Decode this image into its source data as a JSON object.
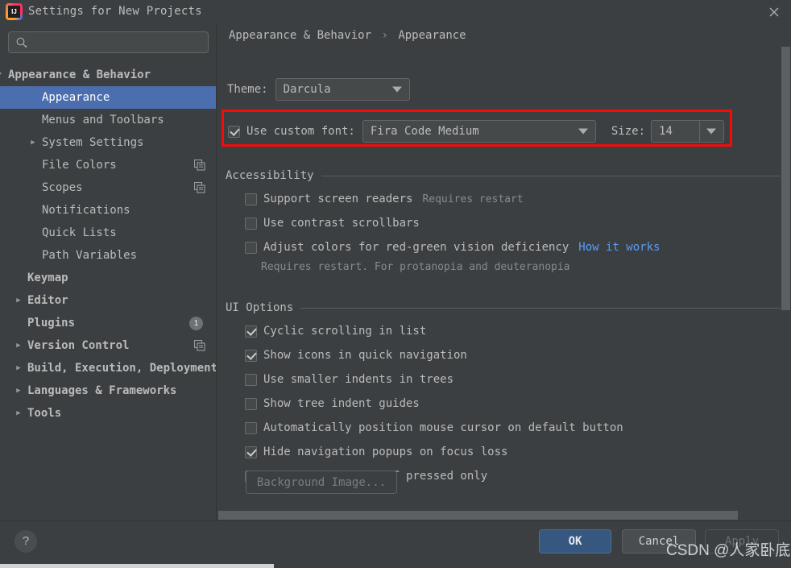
{
  "window": {
    "title": "Settings for New Projects",
    "app_icon": "intellij-idea-icon",
    "close_icon": "close-icon"
  },
  "sidebar": {
    "search": {
      "placeholder": "",
      "value": "",
      "icon": "search-icon"
    },
    "items": [
      {
        "label": "Appearance & Behavior",
        "indent": 10,
        "arrow": "down",
        "selected": false,
        "badge": null,
        "secondary_icon": null,
        "bold": true
      },
      {
        "label": "Appearance",
        "indent": 52,
        "arrow": null,
        "selected": true,
        "badge": null,
        "secondary_icon": null,
        "bold": false
      },
      {
        "label": "Menus and Toolbars",
        "indent": 52,
        "arrow": null,
        "selected": false,
        "badge": null,
        "secondary_icon": null,
        "bold": false
      },
      {
        "label": "System Settings",
        "indent": 52,
        "arrow": "right",
        "selected": false,
        "badge": null,
        "secondary_icon": null,
        "bold": false
      },
      {
        "label": "File Colors",
        "indent": 52,
        "arrow": null,
        "selected": false,
        "badge": null,
        "secondary_icon": "copy-icon",
        "bold": false
      },
      {
        "label": "Scopes",
        "indent": 52,
        "arrow": null,
        "selected": false,
        "badge": null,
        "secondary_icon": "copy-icon",
        "bold": false
      },
      {
        "label": "Notifications",
        "indent": 52,
        "arrow": null,
        "selected": false,
        "badge": null,
        "secondary_icon": null,
        "bold": false
      },
      {
        "label": "Quick Lists",
        "indent": 52,
        "arrow": null,
        "selected": false,
        "badge": null,
        "secondary_icon": null,
        "bold": false
      },
      {
        "label": "Path Variables",
        "indent": 52,
        "arrow": null,
        "selected": false,
        "badge": null,
        "secondary_icon": null,
        "bold": false
      },
      {
        "label": "Keymap",
        "indent": 34,
        "arrow": null,
        "selected": false,
        "badge": null,
        "secondary_icon": null,
        "bold": true
      },
      {
        "label": "Editor",
        "indent": 34,
        "arrow": "right",
        "selected": false,
        "badge": null,
        "secondary_icon": null,
        "bold": true
      },
      {
        "label": "Plugins",
        "indent": 34,
        "arrow": null,
        "selected": false,
        "badge": "1",
        "secondary_icon": null,
        "bold": true
      },
      {
        "label": "Version Control",
        "indent": 34,
        "arrow": "right",
        "selected": false,
        "badge": null,
        "secondary_icon": "copy-icon",
        "bold": true
      },
      {
        "label": "Build, Execution, Deployment",
        "indent": 34,
        "arrow": "right",
        "selected": false,
        "badge": null,
        "secondary_icon": null,
        "bold": true
      },
      {
        "label": "Languages & Frameworks",
        "indent": 34,
        "arrow": "right",
        "selected": false,
        "badge": null,
        "secondary_icon": null,
        "bold": true
      },
      {
        "label": "Tools",
        "indent": 34,
        "arrow": "right",
        "selected": false,
        "badge": null,
        "secondary_icon": null,
        "bold": true
      }
    ]
  },
  "main": {
    "breadcrumb": {
      "parent": "Appearance & Behavior",
      "separator": "›",
      "current": "Appearance"
    },
    "theme": {
      "label": "Theme:",
      "value": "Darcula",
      "arrow_icon": "chevron-down-icon"
    },
    "custom_font": {
      "checkbox_checked": true,
      "label": "Use custom font:",
      "font_value": "Fira Code Medium",
      "size_label": "Size:",
      "size_value": "14",
      "highlight_color": "#f60b08"
    },
    "accessibility": {
      "title": "Accessibility",
      "options": [
        {
          "label": "Support screen readers",
          "checked": false,
          "hint": "Requires restart",
          "link": null
        },
        {
          "label": "Use contrast scrollbars",
          "checked": false,
          "hint": null,
          "link": null
        },
        {
          "label": "Adjust colors for red-green vision deficiency",
          "checked": false,
          "hint": null,
          "link": "How it works"
        }
      ],
      "note": "Requires restart. For protanopia and deuteranopia"
    },
    "ui_options": {
      "title": "UI Options",
      "options": [
        {
          "label": "Cyclic scrolling in list",
          "checked": true
        },
        {
          "label": "Show icons in quick navigation",
          "checked": true
        },
        {
          "label": "Use smaller indents in trees",
          "checked": false
        },
        {
          "label": "Show tree indent guides",
          "checked": false
        },
        {
          "label": "Automatically position mouse cursor on default button",
          "checked": false
        },
        {
          "label": "Hide navigation popups on focus loss",
          "checked": true
        },
        {
          "label": "Drag-n-Drop with ALT pressed only",
          "checked": false
        }
      ]
    },
    "background_image_button": "Background Image..."
  },
  "footer": {
    "help_label": "?",
    "ok_label": "OK",
    "cancel_label": "Cancel",
    "apply_label": "Apply"
  },
  "watermark": "CSDN @人家卧底",
  "colors": {
    "window_bg": "#3c3f41",
    "selection_blue": "#4b6eaf",
    "field_bg": "#45494a",
    "text": "#bbbbbb",
    "link_blue": "#589df6",
    "highlight_red": "#f60b08",
    "ok_button": "#365880"
  }
}
